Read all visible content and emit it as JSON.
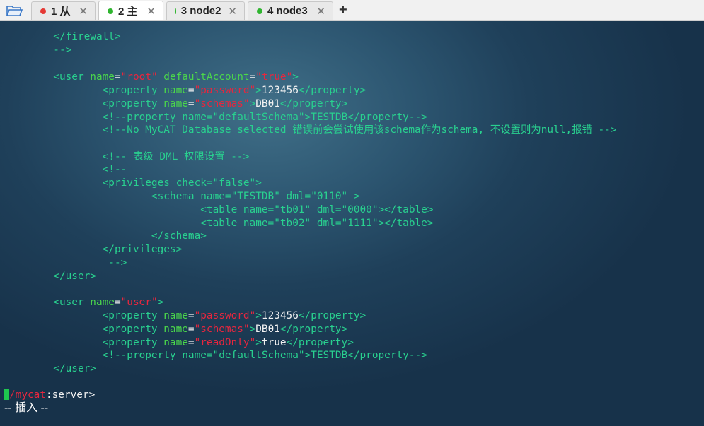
{
  "tabs": [
    {
      "label": "1 从",
      "dot_color": "#e53935",
      "active": false
    },
    {
      "label": "2 主",
      "dot_color": "#2fb52f",
      "active": true
    },
    {
      "label": "3 node2",
      "dot_color": "#2fb52f",
      "active": false
    },
    {
      "label": "4 node3",
      "dot_color": "#2fb52f",
      "active": false
    }
  ],
  "tab_close_glyph": "✕",
  "new_tab_glyph": "+",
  "lines": [
    [
      [
        "tag",
        "        </firewall>"
      ]
    ],
    [
      [
        "comment",
        "        -->"
      ]
    ],
    [],
    [
      [
        "tag",
        "        <user "
      ],
      [
        "attr",
        "name"
      ],
      [
        "txt",
        "="
      ],
      [
        "str",
        "\"root\""
      ],
      [
        "tag",
        " "
      ],
      [
        "attr",
        "defaultAccount"
      ],
      [
        "txt",
        "="
      ],
      [
        "str",
        "\"true\""
      ],
      [
        "tag",
        ">"
      ]
    ],
    [
      [
        "tag",
        "                <property "
      ],
      [
        "attr",
        "name"
      ],
      [
        "txt",
        "="
      ],
      [
        "str",
        "\"password\""
      ],
      [
        "tag",
        ">"
      ],
      [
        "txt",
        "123456"
      ],
      [
        "tag",
        "</property>"
      ]
    ],
    [
      [
        "tag",
        "                <property "
      ],
      [
        "attr",
        "name"
      ],
      [
        "txt",
        "="
      ],
      [
        "str",
        "\"schemas\""
      ],
      [
        "tag",
        ">"
      ],
      [
        "txt",
        "DB01"
      ],
      [
        "tag",
        "</property>"
      ]
    ],
    [
      [
        "comment",
        "                <!--property name=\"defaultSchema\">TESTDB</property-->"
      ]
    ],
    [
      [
        "comment",
        "                <!--No MyCAT Database selected 错误前会尝试使用该schema作为schema, 不设置则为null,报错 -->"
      ]
    ],
    [],
    [
      [
        "comment",
        "                <!-- 表级 DML 权限设置 -->"
      ]
    ],
    [
      [
        "comment",
        "                <!--"
      ]
    ],
    [
      [
        "comment",
        "                <privileges check=\"false\">"
      ]
    ],
    [
      [
        "comment",
        "                        <schema name=\"TESTDB\" dml=\"0110\" >"
      ]
    ],
    [
      [
        "comment",
        "                                <table name=\"tb01\" dml=\"0000\"></table>"
      ]
    ],
    [
      [
        "comment",
        "                                <table name=\"tb02\" dml=\"1111\"></table>"
      ]
    ],
    [
      [
        "comment",
        "                        </schema>"
      ]
    ],
    [
      [
        "comment",
        "                </privileges>"
      ]
    ],
    [
      [
        "comment",
        "                 -->"
      ]
    ],
    [
      [
        "tag",
        "        </user>"
      ]
    ],
    [],
    [
      [
        "tag",
        "        <user "
      ],
      [
        "attr",
        "name"
      ],
      [
        "txt",
        "="
      ],
      [
        "str",
        "\"user\""
      ],
      [
        "tag",
        ">"
      ]
    ],
    [
      [
        "tag",
        "                <property "
      ],
      [
        "attr",
        "name"
      ],
      [
        "txt",
        "="
      ],
      [
        "str",
        "\"password\""
      ],
      [
        "tag",
        ">"
      ],
      [
        "txt",
        "123456"
      ],
      [
        "tag",
        "</property>"
      ]
    ],
    [
      [
        "tag",
        "                <property "
      ],
      [
        "attr",
        "name"
      ],
      [
        "txt",
        "="
      ],
      [
        "str",
        "\"schemas\""
      ],
      [
        "tag",
        ">"
      ],
      [
        "txt",
        "DB01"
      ],
      [
        "tag",
        "</property>"
      ]
    ],
    [
      [
        "tag",
        "                <property "
      ],
      [
        "attr",
        "name"
      ],
      [
        "txt",
        "="
      ],
      [
        "str",
        "\"readOnly\""
      ],
      [
        "tag",
        ">"
      ],
      [
        "txt",
        "true"
      ],
      [
        "tag",
        "</property>"
      ]
    ],
    [
      [
        "comment",
        "                <!--property name=\"defaultSchema\">TESTDB</property-->"
      ]
    ],
    [
      [
        "tag",
        "        </user>"
      ]
    ],
    [],
    [
      [
        "prompt-path",
        "/mycat"
      ],
      [
        "prompt-rest",
        ":server>"
      ]
    ]
  ],
  "status_line": "-- 插入 --"
}
